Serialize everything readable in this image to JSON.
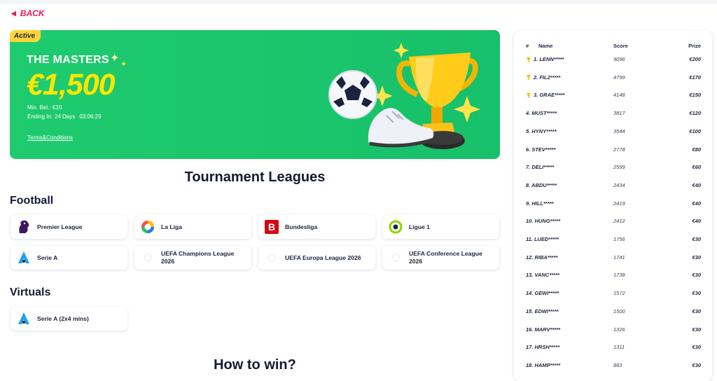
{
  "nav": {
    "back_label": "BACK"
  },
  "banner": {
    "badge": "Active",
    "title": "THE MASTERS",
    "amount": "€1,500",
    "min_bet": "Min. Bet.: €10",
    "ending_label": "Ending In:",
    "ending_days": "24 Days",
    "ending_time": "03:06:29",
    "terms_label": "Terms&Conditions"
  },
  "leagues_title": "Tournament Leagues",
  "football": {
    "title": "Football",
    "leagues": [
      {
        "label": "Premier League",
        "icon": "premier-league-icon"
      },
      {
        "label": "La Liga",
        "icon": "la-liga-icon"
      },
      {
        "label": "Bundesliga",
        "icon": "bundesliga-icon"
      },
      {
        "label": "Ligue 1",
        "icon": "ligue-1-icon"
      },
      {
        "label": "Serie A",
        "icon": "serie-a-icon"
      },
      {
        "label": "UEFA Champions League 2026",
        "icon": "uefa-icon"
      },
      {
        "label": "UEFA Europa League 2026",
        "icon": "uefa-icon"
      },
      {
        "label": "UEFA Conference League 2026",
        "icon": "uefa-icon"
      }
    ]
  },
  "virtuals": {
    "title": "Virtuals",
    "leagues": [
      {
        "label": "Serie A (2x4 mins)",
        "icon": "serie-a-icon"
      }
    ]
  },
  "how_to_win_title": "How to win?",
  "leaderboard": {
    "headers": {
      "rank": "#",
      "name": "Name",
      "score": "Score",
      "prize": "Prize"
    },
    "rows": [
      {
        "name": "1. LENN*****",
        "score": "9096",
        "prize": "€200",
        "trophy": true
      },
      {
        "name": "2. FIL2*****",
        "score": "4799",
        "prize": "€170",
        "trophy": true
      },
      {
        "name": "3. GRAE*****",
        "score": "4148",
        "prize": "€150",
        "trophy": true
      },
      {
        "name": "4. MUST*****",
        "score": "3817",
        "prize": "€120",
        "trophy": false
      },
      {
        "name": "5. HYNY*****",
        "score": "3544",
        "prize": "€100",
        "trophy": false
      },
      {
        "name": "6. STEV*****",
        "score": "2778",
        "prize": "€80",
        "trophy": false
      },
      {
        "name": "7. DELI*****",
        "score": "2599",
        "prize": "€60",
        "trophy": false
      },
      {
        "name": "8. ABDU*****",
        "score": "2434",
        "prize": "€40",
        "trophy": false
      },
      {
        "name": "9. HILL*****",
        "score": "2419",
        "prize": "€40",
        "trophy": false
      },
      {
        "name": "10. HUNG*****",
        "score": "2412",
        "prize": "€40",
        "trophy": false
      },
      {
        "name": "11. LUED*****",
        "score": "1756",
        "prize": "€30",
        "trophy": false
      },
      {
        "name": "12. RIBA*****",
        "score": "1741",
        "prize": "€30",
        "trophy": false
      },
      {
        "name": "13. VANC*****",
        "score": "1738",
        "prize": "€30",
        "trophy": false
      },
      {
        "name": "14. GEWI*****",
        "score": "1572",
        "prize": "€30",
        "trophy": false
      },
      {
        "name": "15. EDWI*****",
        "score": "1500",
        "prize": "€30",
        "trophy": false
      },
      {
        "name": "16. MARV*****",
        "score": "1326",
        "prize": "€30",
        "trophy": false
      },
      {
        "name": "17. HRSH*****",
        "score": "1311",
        "prize": "€30",
        "trophy": false
      },
      {
        "name": "18. HAMP*****",
        "score": "883",
        "prize": "€30",
        "trophy": false
      }
    ]
  }
}
